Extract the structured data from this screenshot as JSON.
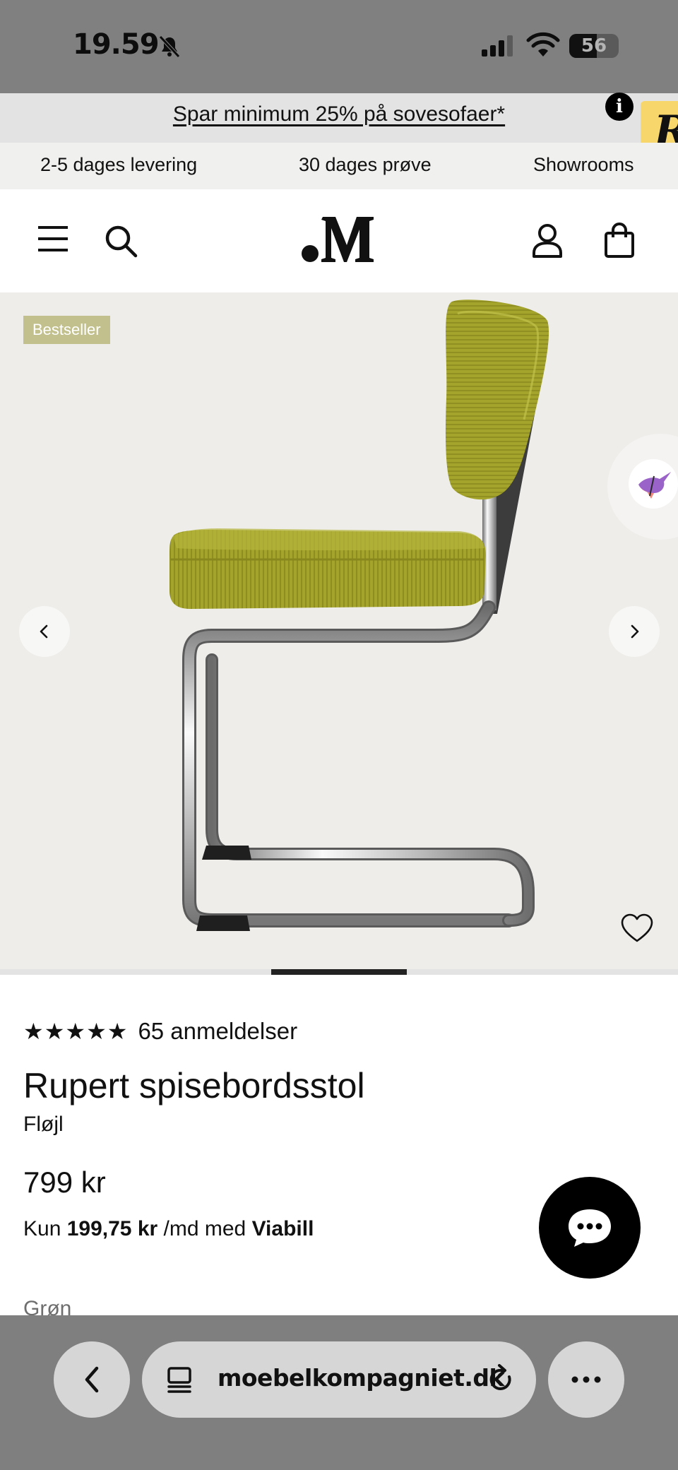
{
  "status_bar": {
    "time": "19.59",
    "battery_text": "56",
    "battery_level": 0.56,
    "icons": [
      "bell-slash-icon",
      "signal-icon",
      "wifi-icon",
      "battery-icon"
    ]
  },
  "promo": {
    "text": "Spar minimum 25% på sovesofaer*",
    "badge_letter": "R",
    "info_label": "i"
  },
  "usp": {
    "items": [
      "2-5 dages levering",
      "30 dages prøve",
      "Showrooms"
    ]
  },
  "header": {
    "icons": [
      "hamburger-menu-icon",
      "search-icon",
      "account-icon",
      "shopping-bag-icon"
    ],
    "logo": "M"
  },
  "gallery": {
    "badge": "Bestseller",
    "current_slide": 3,
    "slide_count": 5
  },
  "product": {
    "stars": "★★★★★",
    "rating": 5,
    "review_count_text": "65 anmeldelser",
    "title": "Rupert spisebordsstol",
    "variant": "Fløjl",
    "price": "799 kr",
    "financing": {
      "prefix": "Kun",
      "amount": "199,75 kr",
      "middle": "/md med",
      "provider": "Viabill"
    },
    "color_label": "Grøn"
  },
  "colors": {
    "chair_fabric": "#a4a42c",
    "badge_bg": "#c2c18d",
    "promo_badge": "#f7d66b",
    "gallery_bg": "#eeedea"
  },
  "browser": {
    "url": "moebelkompagniet.dk",
    "icons": [
      "back-chevron-icon",
      "tab-overview-icon",
      "reload-icon",
      "more-icon"
    ]
  }
}
